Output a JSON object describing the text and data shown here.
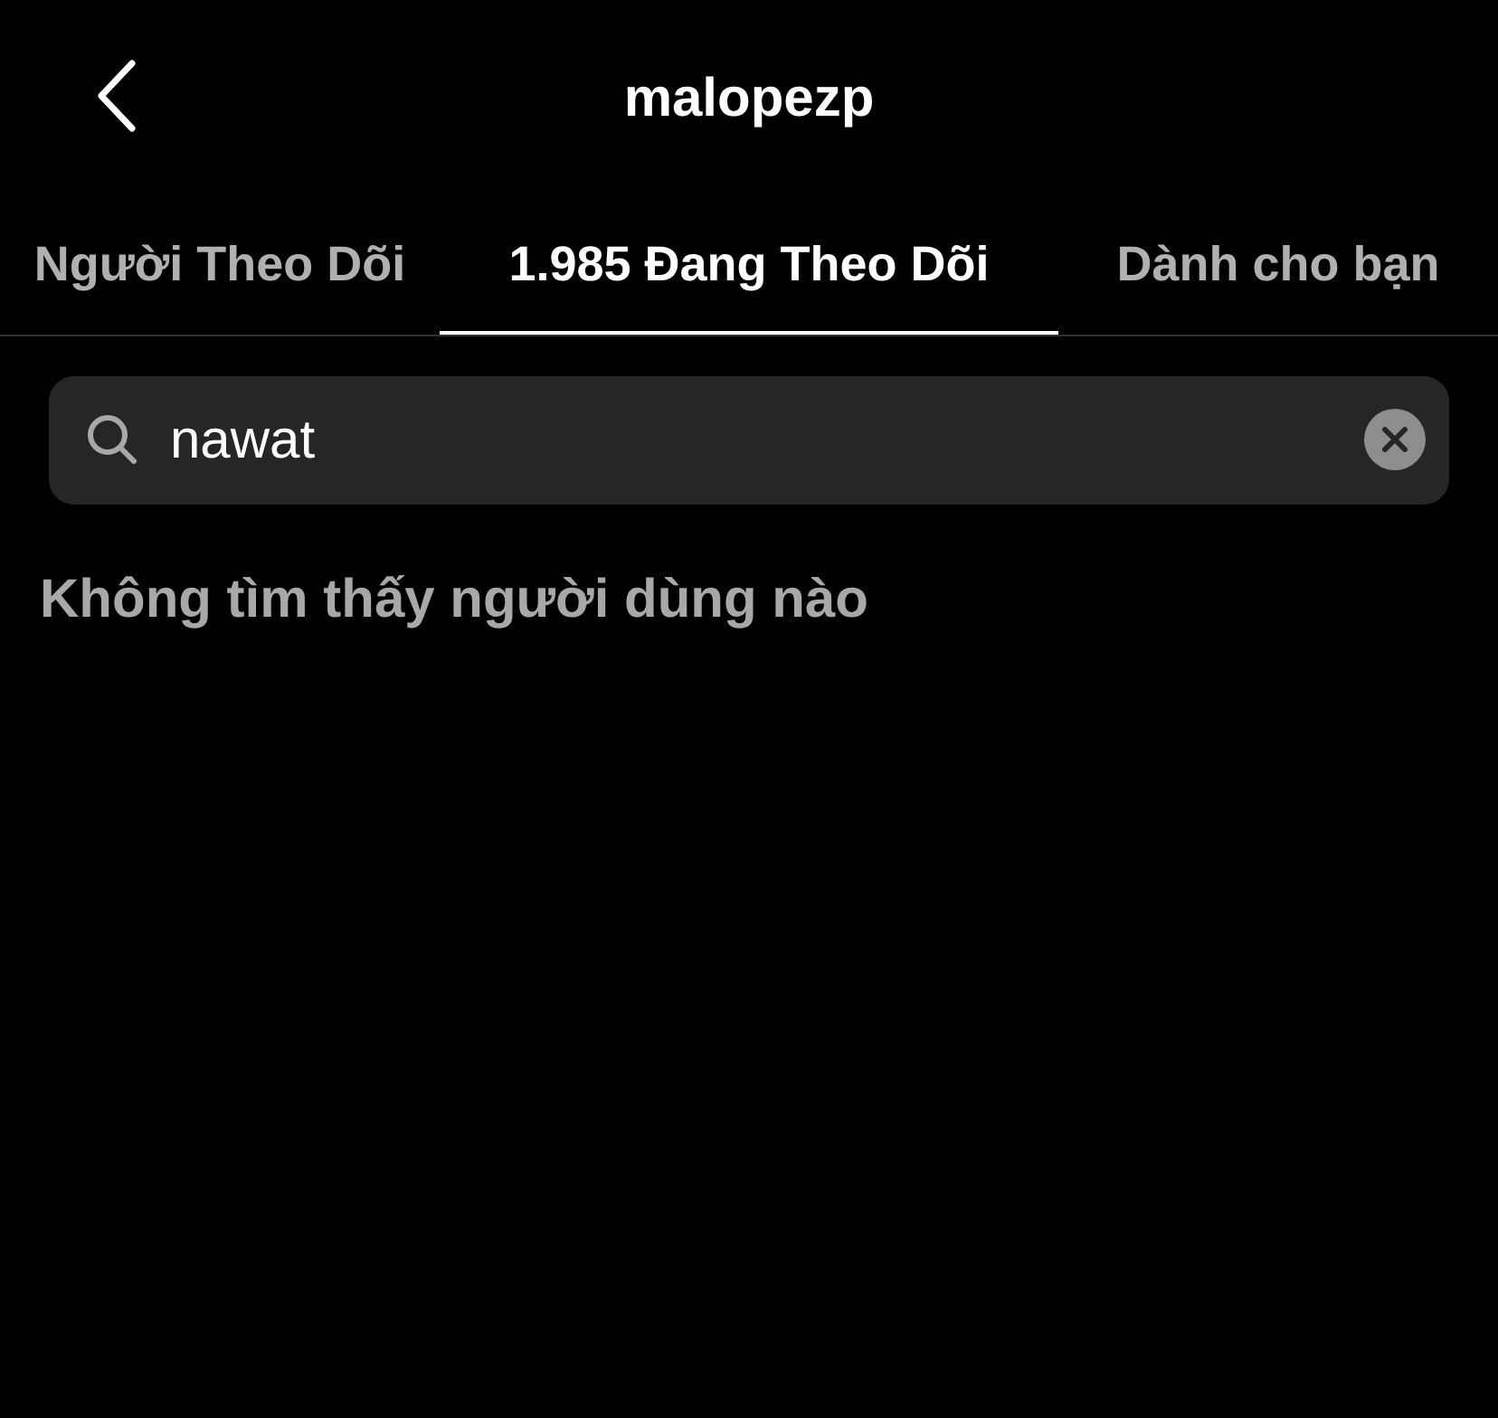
{
  "header": {
    "title": "malopezp"
  },
  "tabs": [
    {
      "label": "Người Theo Dõi",
      "selected": false
    },
    {
      "label": "1.985 Đang Theo Dõi",
      "selected": true
    },
    {
      "label": "Dành cho bạn",
      "selected": false
    }
  ],
  "search": {
    "value": "nawat"
  },
  "message": "Không tìm thấy người dùng nào"
}
